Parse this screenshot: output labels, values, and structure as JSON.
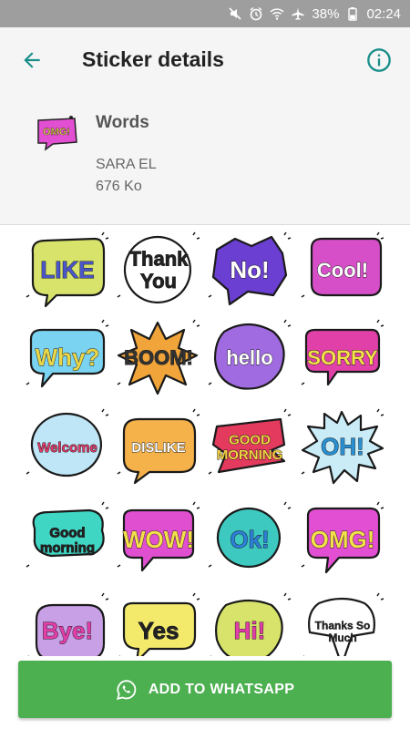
{
  "status_bar": {
    "battery": "38%",
    "time": "02:24",
    "icons": [
      "mute-icon",
      "alarm-icon",
      "wifi-icon",
      "airplane-icon",
      "battery-icon"
    ]
  },
  "app_bar": {
    "title": "Sticker details",
    "back_icon": "arrow-back-icon",
    "info_icon": "info-icon",
    "accent": "#1a8f8a"
  },
  "pack": {
    "name": "Words",
    "publisher": "SARA EL",
    "size": "676 Ko",
    "tray_text": "OMG!"
  },
  "stickers": [
    {
      "text": "LIKE",
      "bubble": "#d7e36a",
      "ink": "#4a56c8"
    },
    {
      "text": "Thank You",
      "bubble": "#ffffff",
      "ink": "#222222"
    },
    {
      "text": "No!",
      "bubble": "#6a3fd1",
      "ink": "#ffffff"
    },
    {
      "text": "Cool!",
      "bubble": "#d64fc9",
      "ink": "#ffffff"
    },
    {
      "text": "Why?",
      "bubble": "#7ad3f0",
      "ink": "#e8d64a"
    },
    {
      "text": "BOOM!",
      "bubble": "#f0a43a",
      "ink": "#333333"
    },
    {
      "text": "hello",
      "bubble": "#a06be0",
      "ink": "#ffffff"
    },
    {
      "text": "SORRY",
      "bubble": "#e040a8",
      "ink": "#f5e04a"
    },
    {
      "text": "Welcome",
      "bubble": "#bfe6f7",
      "ink": "#e23b6a"
    },
    {
      "text": "DISLIKE",
      "bubble": "#f5b24a",
      "ink": "#ffffff"
    },
    {
      "text": "GOOD MORNING",
      "bubble": "#e33a5e",
      "ink": "#f4d442"
    },
    {
      "text": "OH!",
      "bubble": "#c9ecf7",
      "ink": "#2a8fd0"
    },
    {
      "text": "Good morning",
      "bubble": "#3fd6c4",
      "ink": "#222222"
    },
    {
      "text": "WOW!",
      "bubble": "#e04fd0",
      "ink": "#f4e04a"
    },
    {
      "text": "Ok!",
      "bubble": "#3ec9c0",
      "ink": "#2d7fd6"
    },
    {
      "text": "OMG!",
      "bubble": "#e34fd2",
      "ink": "#f4e04a"
    },
    {
      "text": "Bye!",
      "bubble": "#c7a0e6",
      "ink": "#e23ea8"
    },
    {
      "text": "Yes",
      "bubble": "#f3ea6c",
      "ink": "#222222"
    },
    {
      "text": "Hi!",
      "bubble": "#d7e36a",
      "ink": "#e23ea8"
    },
    {
      "text": "Thanks So Much",
      "bubble": "#ffffff",
      "ink": "#222222"
    }
  ],
  "add_button": {
    "label": "ADD TO WHATSAPP",
    "icon": "whatsapp-icon",
    "color": "#4caf50"
  }
}
